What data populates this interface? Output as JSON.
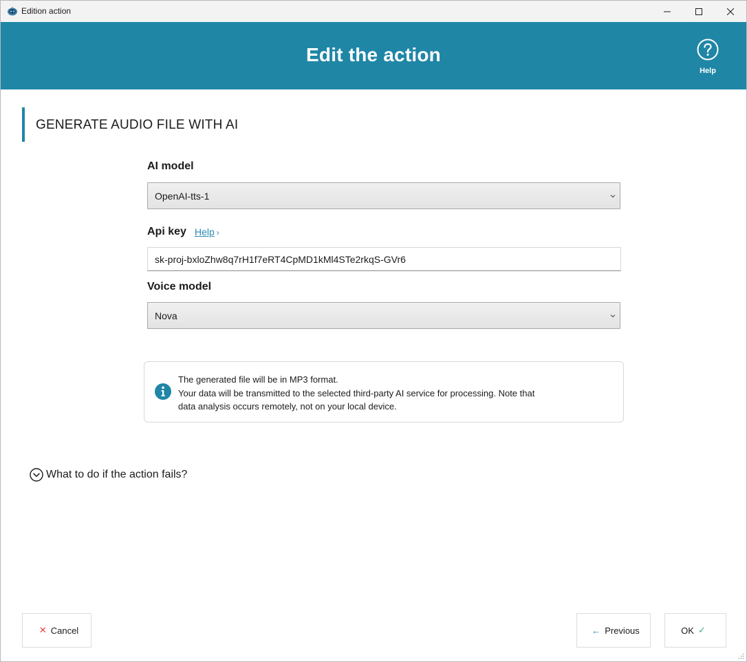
{
  "window": {
    "title": "Edition action"
  },
  "header": {
    "title": "Edit the action",
    "help_label": "Help"
  },
  "section": {
    "title": "GENERATE AUDIO FILE WITH AI"
  },
  "form": {
    "ai_model": {
      "label": "AI model",
      "value": "OpenAI-tts-1"
    },
    "api_key": {
      "label": "Api key",
      "help_link": "Help",
      "value": "sk-proj-bxloZhw8q7rH1f7eRT4CpMD1kMl4STe2rkqS-GVr6"
    },
    "voice_model": {
      "label": "Voice model",
      "value": "Nova"
    }
  },
  "info": {
    "lines": [
      "The generated file will be in MP3 format.",
      "Your data will be transmitted to the selected third-party AI service for processing. Note that",
      "data analysis occurs remotely, not on your local device."
    ]
  },
  "failure": {
    "label": "What to do if the action fails?"
  },
  "footer": {
    "cancel_label": "Cancel",
    "previous_label": "Previous",
    "ok_label": "OK"
  },
  "colors": {
    "accent": "#1f86a6",
    "cancel_icon": "#e0413b",
    "ok_icon": "#3aaa8c",
    "link": "#2a8ab0"
  },
  "icons": {
    "app": "robot-app-icon",
    "minimize": "minimize-icon",
    "maximize": "maximize-icon",
    "close": "close-icon",
    "help": "question-circle-icon",
    "select_arrow": "chevron-down-icon",
    "info": "info-icon",
    "expand": "chevron-circle-down-icon",
    "cancel": "x-icon",
    "previous": "arrow-left-icon",
    "ok": "check-icon"
  }
}
